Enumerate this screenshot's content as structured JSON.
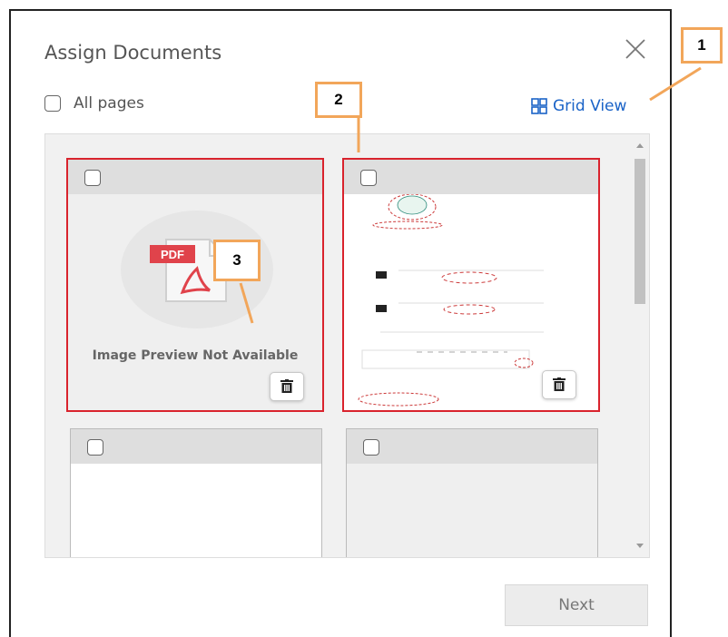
{
  "dialog": {
    "title": "Assign Documents",
    "all_pages_label": "All pages",
    "grid_view_label": "Grid View",
    "next_label": "Next"
  },
  "cards": [
    {
      "file_type": "PDF",
      "preview_text": "Image Preview Not Available",
      "selected": true
    },
    {
      "file_type": "document",
      "selected": true
    },
    {
      "file_type": "blank",
      "selected": false
    },
    {
      "file_type": "blank",
      "selected": false
    }
  ],
  "callouts": [
    "1",
    "2",
    "3"
  ],
  "colors": {
    "accent": "#1a63c7",
    "selected_border": "#d9232d",
    "callout_border": "#f2a65a",
    "pdf_red": "#e0434b"
  },
  "icons": [
    "close-icon",
    "grid-view-icon",
    "trash-icon",
    "pdf-file-icon"
  ]
}
